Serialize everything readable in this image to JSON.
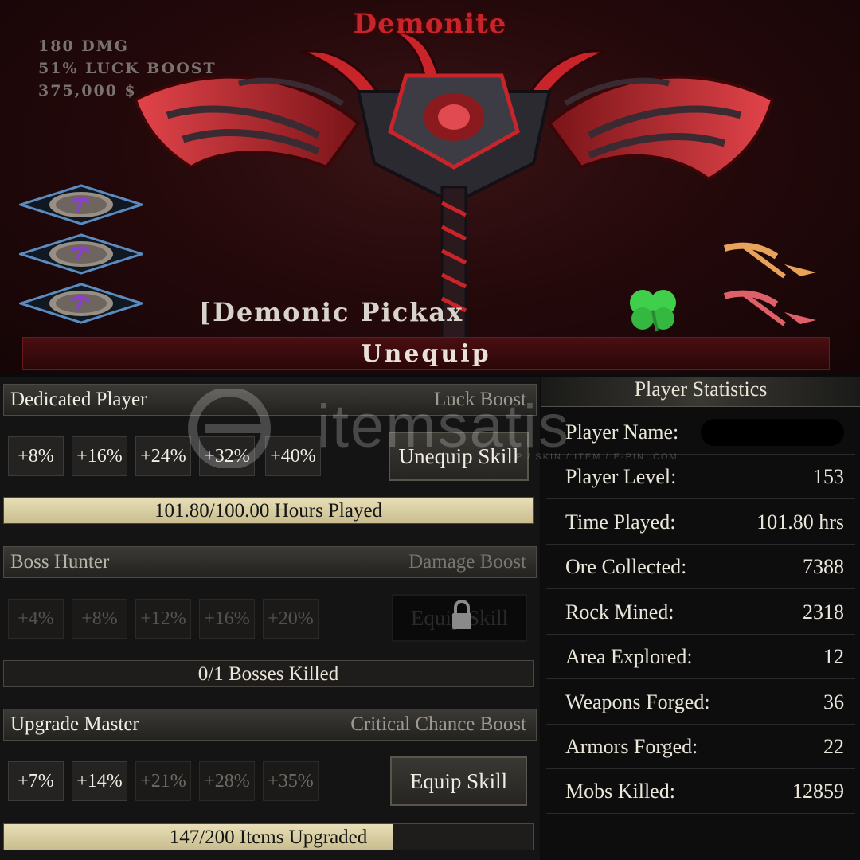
{
  "item": {
    "title": "Demonite",
    "stats": [
      "180 DMG",
      "51% LUCK BOOST",
      "375,000 $"
    ],
    "name": "[Demonic Pickax",
    "unequip_label": "Unequip"
  },
  "skills": [
    {
      "name": "Dedicated Player",
      "boost": "Luck Boost",
      "tiers": [
        "+8%",
        "+16%",
        "+24%",
        "+32%",
        "+40%"
      ],
      "tiers_unlocked": 5,
      "button": "Unequip Skill",
      "button_locked": false,
      "progress_label": "101.80/100.00 Hours Played",
      "progress_fraction": 1.0
    },
    {
      "name": "Boss Hunter",
      "boost": "Damage Boost",
      "tiers": [
        "+4%",
        "+8%",
        "+12%",
        "+16%",
        "+20%"
      ],
      "tiers_unlocked": 0,
      "button": "Equip Skill",
      "button_locked": true,
      "progress_label": "0/1 Bosses Killed",
      "progress_fraction": 0.0
    },
    {
      "name": "Upgrade Master",
      "boost": "Critical Chance Boost",
      "tiers": [
        "+7%",
        "+14%",
        "+21%",
        "+28%",
        "+35%"
      ],
      "tiers_unlocked": 2,
      "button": "Equip Skill",
      "button_locked": false,
      "progress_label": "147/200 Items Upgraded",
      "progress_fraction": 0.735
    }
  ],
  "statistics": {
    "title": "Player Statistics",
    "rows": [
      {
        "label": "Player Name:",
        "value": ""
      },
      {
        "label": "Player Level:",
        "value": "153"
      },
      {
        "label": "Time Played:",
        "value": "101.80 hrs"
      },
      {
        "label": "Ore Collected:",
        "value": "7388"
      },
      {
        "label": "Rock Mined:",
        "value": "2318"
      },
      {
        "label": "Area Explored:",
        "value": "12"
      },
      {
        "label": "Weapons Forged:",
        "value": "36"
      },
      {
        "label": "Armors Forged:",
        "value": "22"
      },
      {
        "label": "Mobs Killed:",
        "value": "12859"
      }
    ]
  },
  "watermark": {
    "text": "itemsatis",
    "sub": "P / SKIN / ITEM / E-PIN .COM"
  },
  "colors": {
    "accent_red": "#c8242a",
    "progress_fill": "#e8dfb8",
    "gem_purple": "#8a3fd0"
  },
  "icons": {
    "gem": "gem-slot-icon",
    "pickaxe_gold": "pickaxe-icon",
    "pickaxe_red": "pickaxe-icon",
    "clover": "clover-icon",
    "lock": "lock-icon"
  }
}
